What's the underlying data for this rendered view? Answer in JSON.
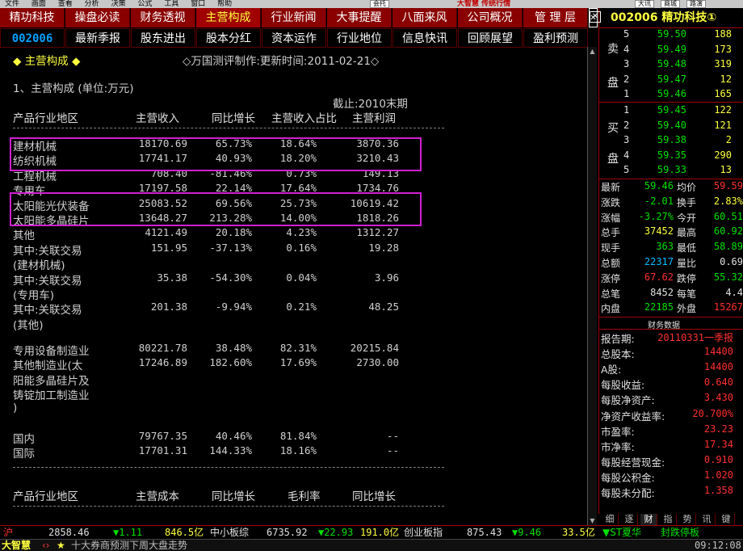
{
  "menu": [
    "文件",
    "画面",
    "查看",
    "分析",
    "决策",
    "公式",
    "工具",
    "窗口",
    "帮助"
  ],
  "menu_brand": "大智慧 传统行情",
  "menu_right": [
    "大讯",
    "商城",
    "路演"
  ],
  "menu_extra": "会托",
  "tabs_row1": [
    "精功科技",
    "操盘必读",
    "财务透视",
    "主营构成",
    "行业新闻",
    "大事提醒",
    "八面来风",
    "公司概况",
    "管 理 层"
  ],
  "tabs_row2": [
    "002006",
    "最新季报",
    "股东进出",
    "股本分红",
    "资本运作",
    "行业地位",
    "信息快讯",
    "回顾展望",
    "盈利预测"
  ],
  "content": {
    "section_title": "◆ 主营构成 ◆",
    "source_line": "◇万国测评制作:更新时间:2011-02-21◇",
    "subtitle": "1、主营构成  (单位:万元)",
    "cutoff": "截止:2010末期",
    "headers": [
      "产品行业地区",
      "主营收入",
      "同比增长",
      "主营收入占比",
      "主营利润"
    ],
    "rows": [
      {
        "name": "建材机械",
        "rev": "18170.69",
        "yoy": "65.73%",
        "share": "18.64%",
        "profit": "3870.36"
      },
      {
        "name": "纺织机械",
        "rev": "17741.17",
        "yoy": "40.93%",
        "share": "18.20%",
        "profit": "3210.43"
      },
      {
        "name": "工程机械",
        "rev": "708.40",
        "yoy": "-81.46%",
        "share": "0.73%",
        "profit": "149.13"
      },
      {
        "name": "专用车",
        "rev": "17197.58",
        "yoy": "22.14%",
        "share": "17.64%",
        "profit": "1734.76"
      },
      {
        "name": "太阳能光伏装备",
        "rev": "25083.52",
        "yoy": "69.56%",
        "share": "25.73%",
        "profit": "10619.42"
      },
      {
        "name": "太阳能多晶硅片",
        "rev": "13648.27",
        "yoy": "213.28%",
        "share": "14.00%",
        "profit": "1818.26"
      },
      {
        "name": "其他",
        "rev": "4121.49",
        "yoy": "20.18%",
        "share": "4.23%",
        "profit": "1312.27"
      },
      {
        "name": "其中:关联交易",
        "rev": "151.95",
        "yoy": "-37.13%",
        "share": "0.16%",
        "profit": "19.28"
      },
      {
        "name": "(建材机械)",
        "rev": "",
        "yoy": "",
        "share": "",
        "profit": ""
      },
      {
        "name": "其中:关联交易",
        "rev": "35.38",
        "yoy": "-54.30%",
        "share": "0.04%",
        "profit": "3.96"
      },
      {
        "name": "(专用车)",
        "rev": "",
        "yoy": "",
        "share": "",
        "profit": ""
      },
      {
        "name": "其中:关联交易",
        "rev": "201.38",
        "yoy": "-9.94%",
        "share": "0.21%",
        "profit": "48.25"
      },
      {
        "name": "(其他)",
        "rev": "",
        "yoy": "",
        "share": "",
        "profit": ""
      }
    ],
    "industry_rows": [
      {
        "name": "专用设备制造业",
        "rev": "80221.78",
        "yoy": "38.48%",
        "share": "82.31%",
        "profit": "20215.84"
      },
      {
        "name": "其他制造业(太",
        "rev": "17246.89",
        "yoy": "182.60%",
        "share": "17.69%",
        "profit": "2730.00"
      },
      {
        "name": "阳能多晶硅片及",
        "rev": "",
        "yoy": "",
        "share": "",
        "profit": ""
      },
      {
        "name": "铸锭加工制造业",
        "rev": "",
        "yoy": "",
        "share": "",
        "profit": ""
      },
      {
        "name": ")",
        "rev": "",
        "yoy": "",
        "share": "",
        "profit": ""
      }
    ],
    "region_rows": [
      {
        "name": "国内",
        "rev": "79767.35",
        "yoy": "40.46%",
        "share": "81.84%",
        "profit": "--"
      },
      {
        "name": "国际",
        "rev": "17701.31",
        "yoy": "144.33%",
        "share": "18.16%",
        "profit": "--"
      }
    ],
    "headers2": [
      "产品行业地区",
      "主营成本",
      "同比增长",
      "毛利率",
      "同比增长"
    ]
  },
  "quote": {
    "title": "002006 精功科技①",
    "sell_label": [
      "卖",
      "盘"
    ],
    "buy_label": [
      "买",
      "盘"
    ],
    "sell": [
      {
        "lvl": "5",
        "price": "59.50",
        "vol": "188"
      },
      {
        "lvl": "4",
        "price": "59.49",
        "vol": "173"
      },
      {
        "lvl": "3",
        "price": "59.48",
        "vol": "319"
      },
      {
        "lvl": "2",
        "price": "59.47",
        "vol": "12"
      },
      {
        "lvl": "1",
        "price": "59.46",
        "vol": "165"
      }
    ],
    "buy": [
      {
        "lvl": "1",
        "price": "59.45",
        "vol": "122"
      },
      {
        "lvl": "2",
        "price": "59.40",
        "vol": "121"
      },
      {
        "lvl": "3",
        "price": "59.38",
        "vol": "2"
      },
      {
        "lvl": "4",
        "price": "59.35",
        "vol": "290"
      },
      {
        "lvl": "5",
        "price": "59.33",
        "vol": "13"
      }
    ],
    "stats": [
      {
        "l1": "最新",
        "v1": "59.46",
        "c1": "green",
        "l2": "均价",
        "v2": "59.59",
        "c2": "red"
      },
      {
        "l1": "涨跌",
        "v1": "-2.01",
        "c1": "green",
        "l2": "换手",
        "v2": "2.83%",
        "c2": "yellow"
      },
      {
        "l1": "涨幅",
        "v1": "-3.27%",
        "c1": "green",
        "l2": "今开",
        "v2": "60.51",
        "c2": "green"
      },
      {
        "l1": "总手",
        "v1": "37452",
        "c1": "yellow",
        "l2": "最高",
        "v2": "60.92",
        "c2": "green"
      },
      {
        "l1": "现手",
        "v1": "363",
        "c1": "green",
        "l2": "最低",
        "v2": "58.89",
        "c2": "green"
      },
      {
        "l1": "总额",
        "v1": "22317",
        "c1": "cyan",
        "l2": "量比",
        "v2": "0.69",
        "c2": "white"
      },
      {
        "l1": "涨停",
        "v1": "67.62",
        "c1": "red",
        "l2": "跌停",
        "v2": "55.32",
        "c2": "green"
      },
      {
        "l1": "总笔",
        "v1": "8452",
        "c1": "white",
        "l2": "每笔",
        "v2": "4.4",
        "c2": "white"
      },
      {
        "l1": "内盘",
        "v1": "22185",
        "c1": "green",
        "l2": "外盘",
        "v2": "15267",
        "c2": "red"
      }
    ],
    "fin_title": "财务数据",
    "fin": [
      {
        "label": "报告期:",
        "value": "20110331一季报"
      },
      {
        "label": "总股本:",
        "value": "14400"
      },
      {
        "label": "A股:",
        "value": "14400"
      },
      {
        "label": "每股收益:",
        "value": "0.640"
      },
      {
        "label": "每股净资产:",
        "value": "3.430"
      },
      {
        "label": "净资产收益率:",
        "value": "20.700%"
      },
      {
        "label": "市盈率:",
        "value": "23.23"
      },
      {
        "label": "市净率:",
        "value": "17.34"
      },
      {
        "label": "每股经营现金:",
        "value": "0.910"
      },
      {
        "label": "每股公积金:",
        "value": "1.020"
      },
      {
        "label": "每股未分配:",
        "value": "1.358"
      }
    ],
    "bottom_tabs": [
      "细",
      "逐",
      "财",
      "指",
      "势",
      "讯",
      "键"
    ]
  },
  "status": {
    "sh_label": "沪",
    "sh_index": "2858.46",
    "sh_chg": "▼1.11",
    "sh_amt": "846.5亿",
    "sme_label": "中小板综",
    "sme_index": "6735.92",
    "sme_chg": "▼22.93",
    "sme_amt": "191.0亿",
    "gem_label": "创业板指",
    "gem_index": "875.43",
    "gem_chg": "▼9.46",
    "gem_amt": "33.5亿",
    "news_stock": "▼ST夏华",
    "news_text": "封跌停板"
  },
  "ticker": {
    "brand": "大智慧",
    "headline": "十大券商预测下周大盘走势",
    "time": "09:12:08"
  },
  "colors": {
    "tab_bg": "#8a0000",
    "highlight": "#d020d0",
    "up": "#ff3030",
    "down": "#00e000",
    "accent": "#ffff40"
  }
}
